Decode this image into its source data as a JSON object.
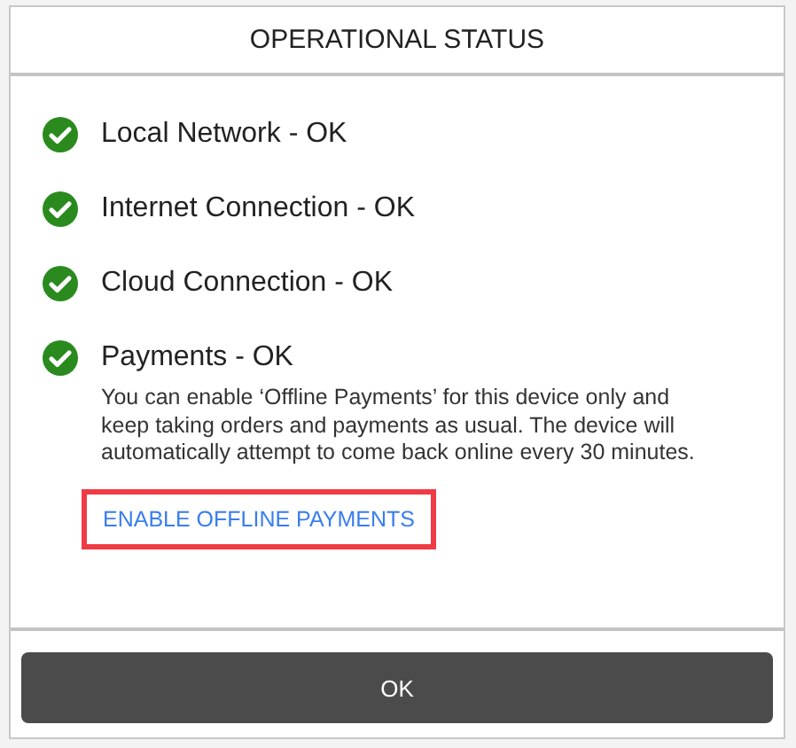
{
  "dialog": {
    "title": "OPERATIONAL STATUS"
  },
  "statuses": [
    {
      "label": "Local Network - OK",
      "ok": true
    },
    {
      "label": "Internet Connection - OK",
      "ok": true
    },
    {
      "label": "Cloud Connection - OK",
      "ok": true
    },
    {
      "label": "Payments - OK",
      "ok": true,
      "description": "You can enable ‘Offline Payments’ for this device only and keep taking orders and payments as usual. The device will automatically attempt to come back online every 30 minutes.",
      "link": {
        "label": "ENABLE OFFLINE PAYMENTS",
        "highlighted": true
      }
    }
  ],
  "buttons": [
    {
      "label": "OK"
    }
  ]
}
